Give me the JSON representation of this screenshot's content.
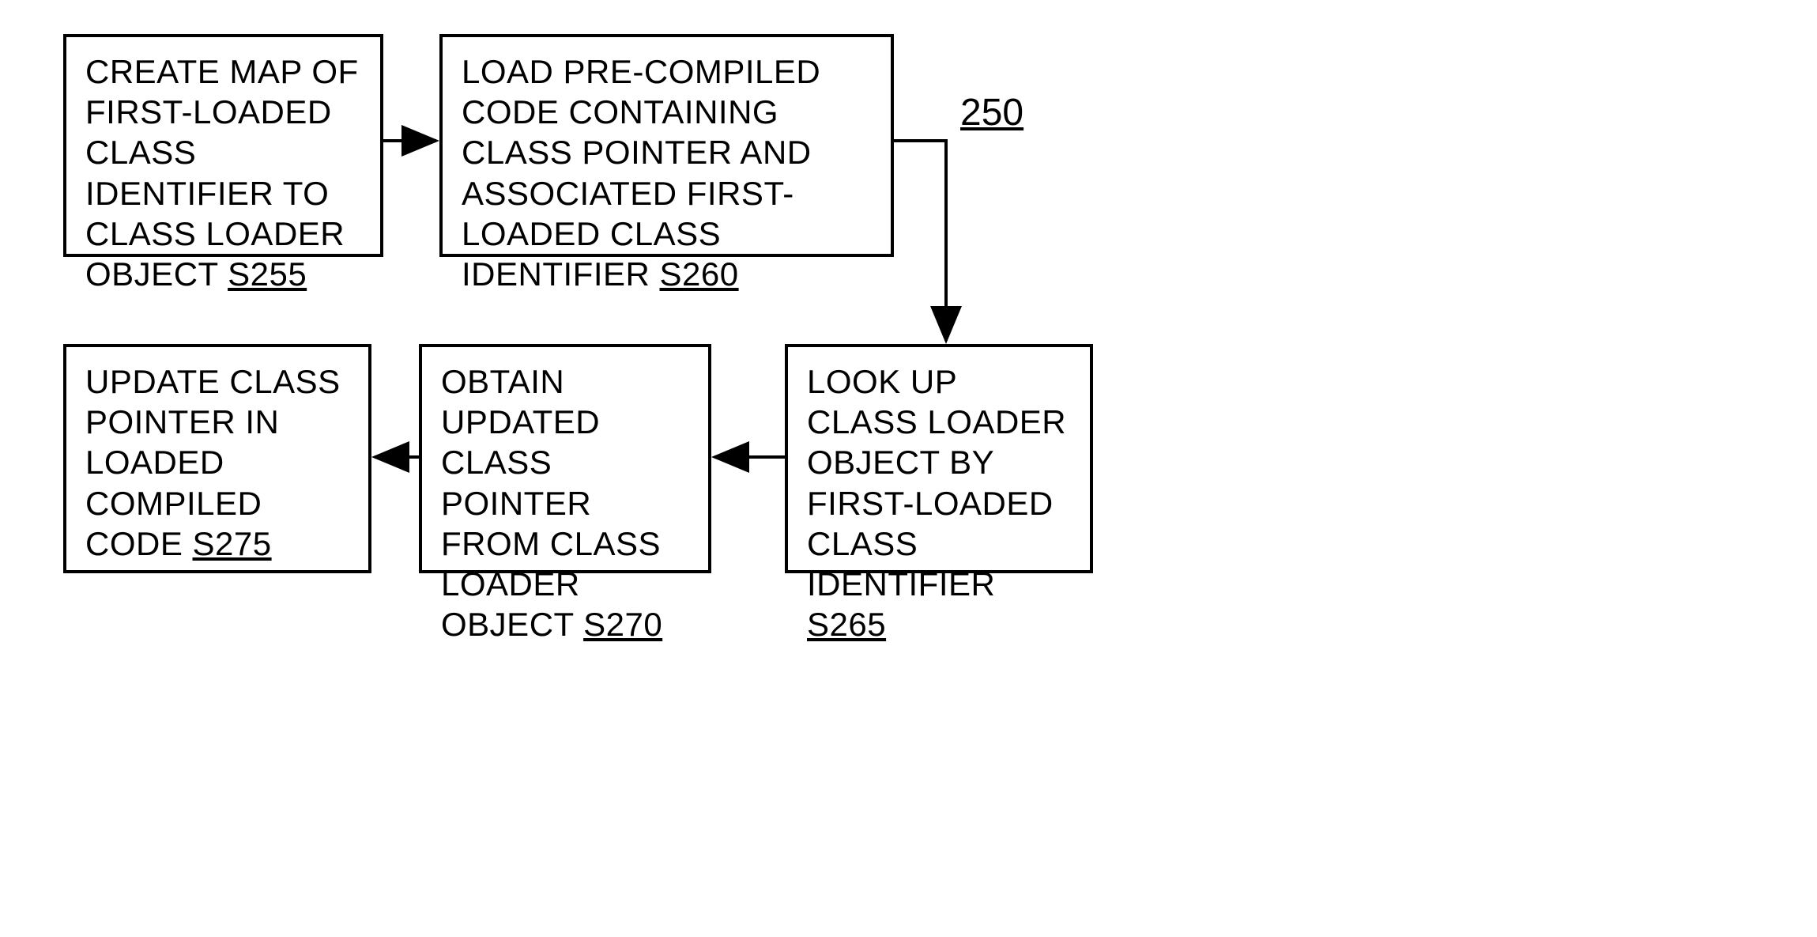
{
  "figure_number": "250",
  "boxes": {
    "s255": {
      "text": "CREATE MAP OF FIRST-LOADED CLASS IDENTIFIER TO CLASS LOADER OBJECT ",
      "ref": "S255"
    },
    "s260": {
      "text": "LOAD PRE-COMPILED CODE CONTAINING CLASS POINTER AND ASSOCIATED FIRST-LOADED CLASS IDENTIFIER ",
      "ref": "S260"
    },
    "s265": {
      "text": "LOOK UP CLASS LOADER OBJECT BY FIRST-LOADED CLASS IDENTIFIER ",
      "ref": "S265"
    },
    "s270": {
      "text": "OBTAIN UPDATED CLASS POINTER FROM CLASS LOADER OBJECT ",
      "ref": "S270"
    },
    "s275": {
      "text": "UPDATE CLASS POINTER IN LOADED COMPILED CODE ",
      "ref": "S275"
    }
  }
}
